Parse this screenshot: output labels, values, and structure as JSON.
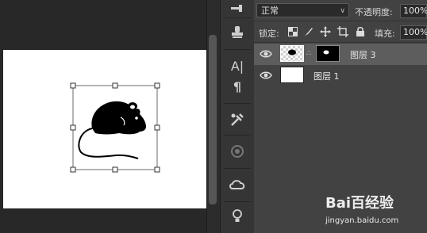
{
  "layers_panel": {
    "blend_mode": "正常",
    "opacity_label": "不透明度:",
    "opacity_value": "100%",
    "lock_label": "锁定:",
    "fill_label": "填充:",
    "fill_value": "100%",
    "layers": [
      {
        "name": "图层 3",
        "selected": true,
        "visible": true,
        "has_mask": true
      },
      {
        "name": "图层 1",
        "selected": false,
        "visible": true,
        "has_mask": false
      }
    ]
  },
  "tools": [
    {
      "icon": "clone-stamp-icon"
    },
    {
      "icon": "type-panel-icon",
      "glyph": "A|"
    },
    {
      "icon": "paragraph-icon",
      "glyph": "¶"
    },
    {
      "icon": "tools-preset-icon"
    },
    {
      "icon": "3d-panel-icon"
    },
    {
      "icon": "cc-libraries-icon"
    },
    {
      "icon": "learn-icon"
    }
  ],
  "watermark": {
    "text": "Bai百经验",
    "url": "jingyan.baidu.com"
  },
  "colors": {
    "panel_bg": "#424242",
    "selected_layer": "#5d5d5d",
    "canvas_bg": "#282828"
  }
}
